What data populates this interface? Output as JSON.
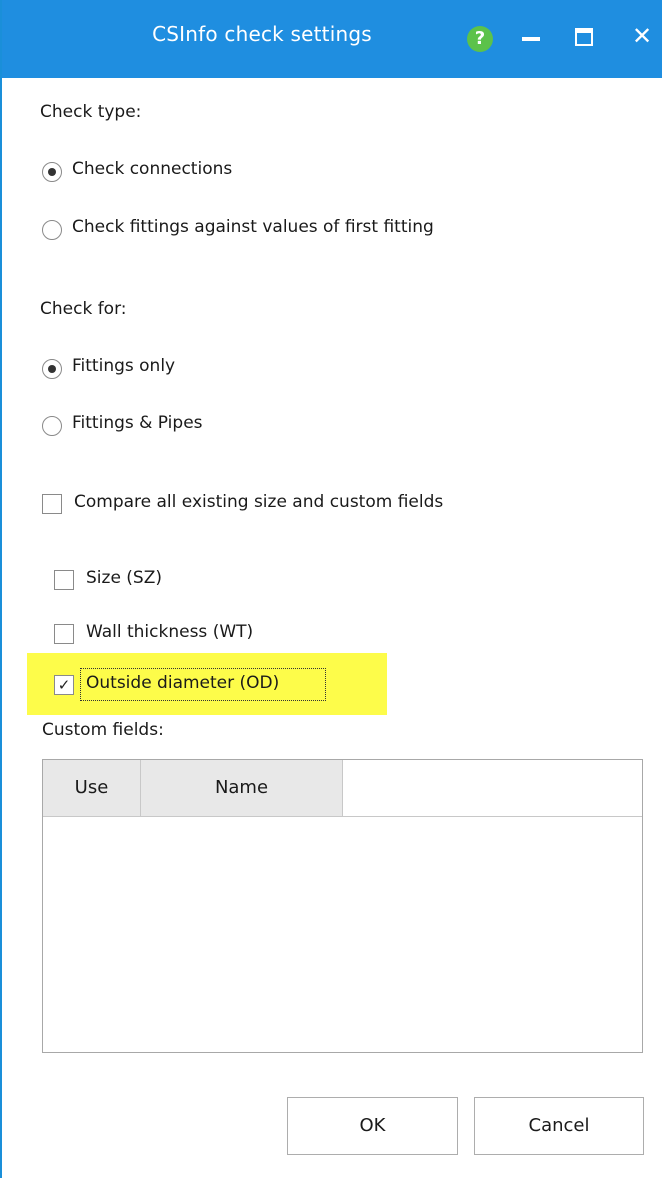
{
  "window": {
    "title": "CSInfo check settings",
    "help_glyph": "?",
    "close_glyph": "✕"
  },
  "check_type": {
    "heading": "Check type:",
    "options": [
      {
        "label": "Check connections",
        "selected": true
      },
      {
        "label": "Check fittings against values of first fitting",
        "selected": false
      }
    ]
  },
  "check_for": {
    "heading": "Check for:",
    "options": [
      {
        "label": "Fittings only",
        "selected": true
      },
      {
        "label": "Fittings & Pipes",
        "selected": false
      }
    ]
  },
  "compare_all": {
    "label": "Compare all existing size and custom fields",
    "checked": false
  },
  "fields": [
    {
      "label": "Size (SZ)",
      "checked": false
    },
    {
      "label": "Wall thickness (WT)",
      "checked": false
    },
    {
      "label": "Outside diameter (OD)",
      "checked": true
    }
  ],
  "custom_fields": {
    "heading": "Custom fields:",
    "columns": [
      "Use",
      "Name",
      ""
    ],
    "rows": []
  },
  "buttons": {
    "ok": "OK",
    "cancel": "Cancel"
  },
  "colors": {
    "titlebar": "#1f8ee0",
    "highlight": "#fdfc4a",
    "help_icon": "#5cc24a"
  }
}
